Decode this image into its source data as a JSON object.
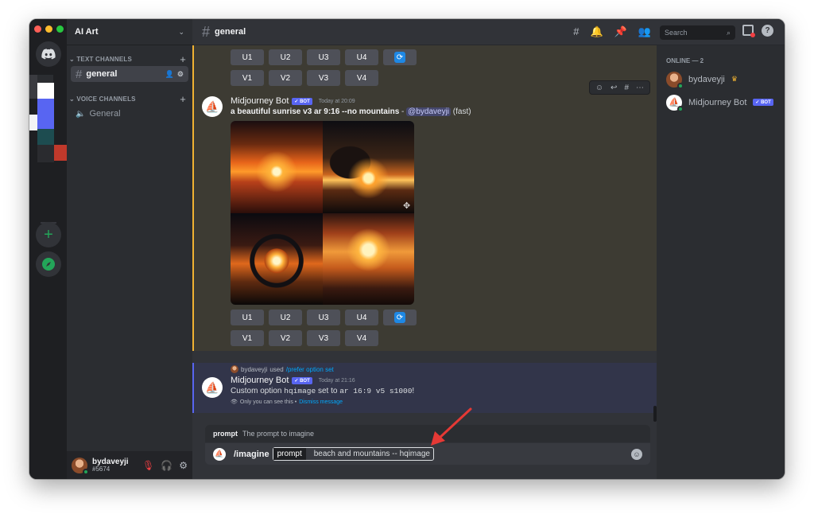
{
  "server": {
    "name": "AI Art"
  },
  "sidebar": {
    "text_channels_label": "TEXT CHANNELS",
    "voice_channels_label": "VOICE CHANNELS",
    "text_channels": [
      {
        "name": "general",
        "active": true
      }
    ],
    "voice_channels": [
      {
        "name": "General"
      }
    ]
  },
  "user": {
    "name": "bydaveyji",
    "tag": "#5674"
  },
  "header": {
    "channel": "general",
    "search_placeholder": "Search"
  },
  "buttons": {
    "upscale": [
      "U1",
      "U2",
      "U3",
      "U4"
    ],
    "variation": [
      "V1",
      "V2",
      "V3",
      "V4"
    ]
  },
  "messages": [
    {
      "author": "Midjourney Bot",
      "badge": "BOT",
      "time": "Today at 20:09",
      "prompt_bold": "a beautiful sunrise v3 ar 9:16 --no mountains",
      "separator": " - ",
      "mention": "@bydaveyji",
      "suffix": " (fast)"
    },
    {
      "reply_user": "bydaveyji",
      "reply_used": " used ",
      "reply_command": "/prefer option set",
      "author": "Midjourney Bot",
      "badge": "BOT",
      "time": "Today at 21:16",
      "text_before": "Custom option ",
      "code1": "hqimage",
      "text_mid": " set to ",
      "code2": "ar 16:9 v5 s1000",
      "text_after": "!",
      "ephemeral_note": "Only you can see this • ",
      "dismiss": "Dismiss message"
    }
  ],
  "command_hint": {
    "name": "prompt",
    "desc": "The prompt to imagine"
  },
  "composer": {
    "command": "/imagine",
    "option_name": "prompt",
    "option_value": "beach and mountains -- hqimage"
  },
  "members": {
    "online_label": "ONLINE — 2",
    "list": [
      {
        "name": "bydaveyji",
        "crown": "♛"
      },
      {
        "name": "Midjourney Bot",
        "badge": "BOT"
      }
    ]
  },
  "colors": {
    "accent": "#5865f2",
    "online": "#23a559",
    "highlight": "#f0b232",
    "arrow": "#e53935"
  }
}
